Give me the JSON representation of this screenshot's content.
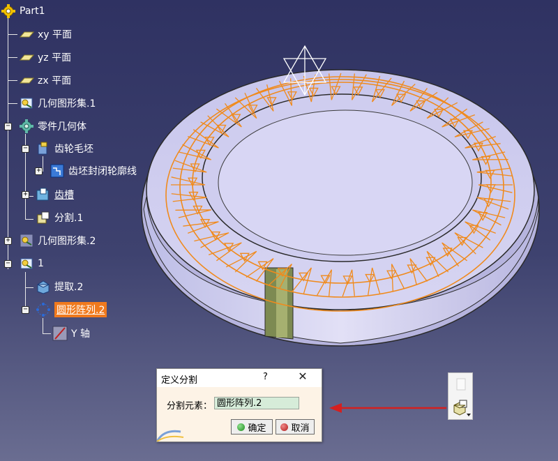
{
  "tree": {
    "root": "Part1",
    "items": [
      {
        "label": "xy 平面"
      },
      {
        "label": "yz 平面"
      },
      {
        "label": "zx 平面"
      },
      {
        "label": "几何图形集.1"
      },
      {
        "label": "零件几何体"
      },
      {
        "label": "齿轮毛坯"
      },
      {
        "label": "齿坯封闭轮廓线"
      },
      {
        "label": "齿槽"
      },
      {
        "label": "分割.1"
      },
      {
        "label": "几何图形集.2"
      },
      {
        "label": "1"
      },
      {
        "label": "提取.2"
      },
      {
        "label": "圆形阵列.2"
      },
      {
        "label": "Y 轴"
      }
    ]
  },
  "dialog": {
    "title": "定义分割",
    "help": "?",
    "close": "✕",
    "field_label": "分割元素：",
    "field_value": "圆形阵列.2",
    "ok_label": "确定",
    "cancel_label": "取消"
  },
  "colors": {
    "background": "#363a68",
    "selection": "#f07a1e",
    "wireframe": "#f08a1c",
    "surface": "#c9c8ec",
    "arrow": "#d42020"
  },
  "toolbar": {
    "icons": [
      "blank-icon",
      "split-icon"
    ]
  }
}
